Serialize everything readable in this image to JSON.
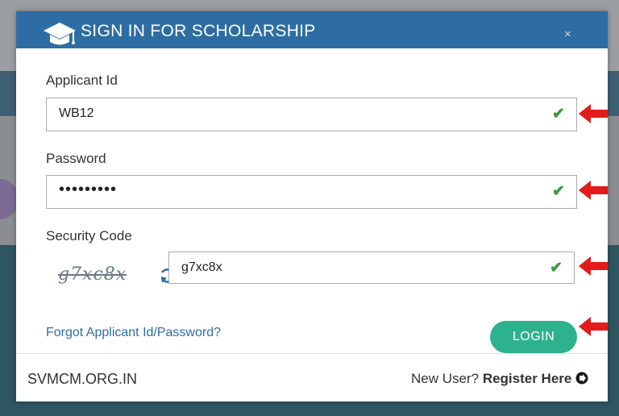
{
  "modal": {
    "title": "SIGN IN FOR SCHOLARSHIP",
    "close_glyph": "×",
    "icons": [
      "graduation-cap-icon",
      "close-icon"
    ],
    "header_color": "#2e6da4"
  },
  "form": {
    "applicant_id": {
      "label": "Applicant Id",
      "value": "WB12",
      "valid": true
    },
    "password": {
      "label": "Password",
      "value": "•••••••••",
      "valid": true
    },
    "security_code": {
      "label": "Security Code",
      "captcha_text": "g7xc8x",
      "value": "g7xc8x",
      "valid": true,
      "refresh_icon": "refresh-icon"
    },
    "check_glyph": "✔",
    "check_color": "#3b9a3f"
  },
  "forgot_link": "Forgot Applicant Id/Password?",
  "login_button": "LOGIN",
  "login_color": "#2eb28d",
  "footer": {
    "site_name": "SVMCM.ORG.IN",
    "new_user_text": "New User? ",
    "register_link": "Register Here"
  },
  "annotation": {
    "arrow_color": "#e31b1b",
    "arrow_icon": "red-arrow-icon"
  }
}
